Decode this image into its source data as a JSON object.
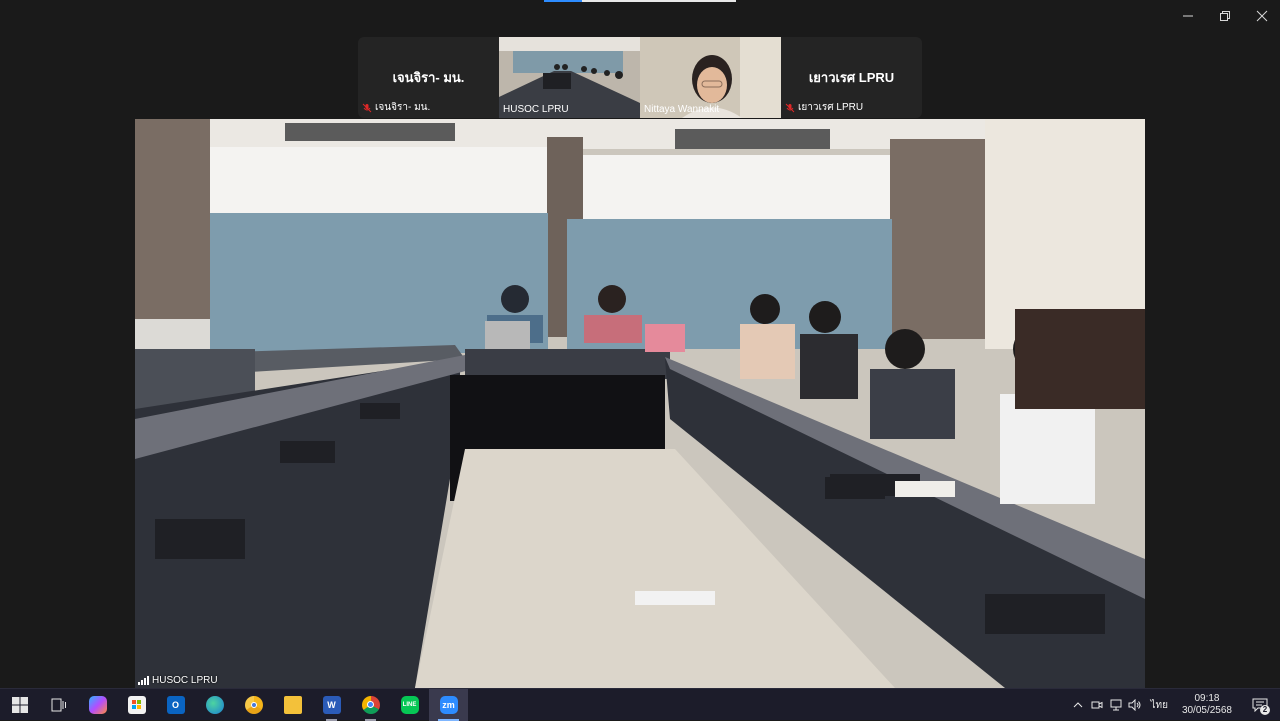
{
  "window": {
    "controls": {
      "minimize": "minimize",
      "restore": "restore",
      "close": "close"
    }
  },
  "participants": [
    {
      "display_name": "เจนจิรา- มน.",
      "tag_label": "เจนจิรา- มน.",
      "muted": true,
      "video": false
    },
    {
      "display_name": "",
      "tag_label": "HUSOC LPRU",
      "muted": false,
      "video": true,
      "active_speaker": true
    },
    {
      "display_name": "",
      "tag_label": "Nittaya Wannakit",
      "muted": false,
      "video": true
    },
    {
      "display_name": "เยาวเรศ LPRU",
      "tag_label": "เยาวเรศ LPRU",
      "muted": true,
      "video": false
    }
  ],
  "main_video": {
    "label": "HUSOC LPRU"
  },
  "taskbar": {
    "apps": [
      {
        "name": "start-icon",
        "label": ""
      },
      {
        "name": "task-view-icon",
        "label": ""
      },
      {
        "name": "copilot-icon",
        "label": ""
      },
      {
        "name": "store-icon",
        "label": ""
      },
      {
        "name": "outlook-icon",
        "label": ""
      },
      {
        "name": "edge-icon",
        "label": ""
      },
      {
        "name": "chrome-canary-icon",
        "label": ""
      },
      {
        "name": "file-explorer-icon",
        "label": ""
      },
      {
        "name": "word-icon",
        "label": ""
      },
      {
        "name": "chrome-icon",
        "label": ""
      },
      {
        "name": "line-icon",
        "label": ""
      },
      {
        "name": "zoom-icon",
        "label": "zm"
      }
    ],
    "language": "ไทย",
    "time": "09:18",
    "date": "30/05/2568",
    "notification_count": "2"
  },
  "colors": {
    "background": "#1a1a1a",
    "active_speaker_border": "#23d959",
    "taskbar": "#1c1c2a",
    "mute_red": "#e02828"
  }
}
